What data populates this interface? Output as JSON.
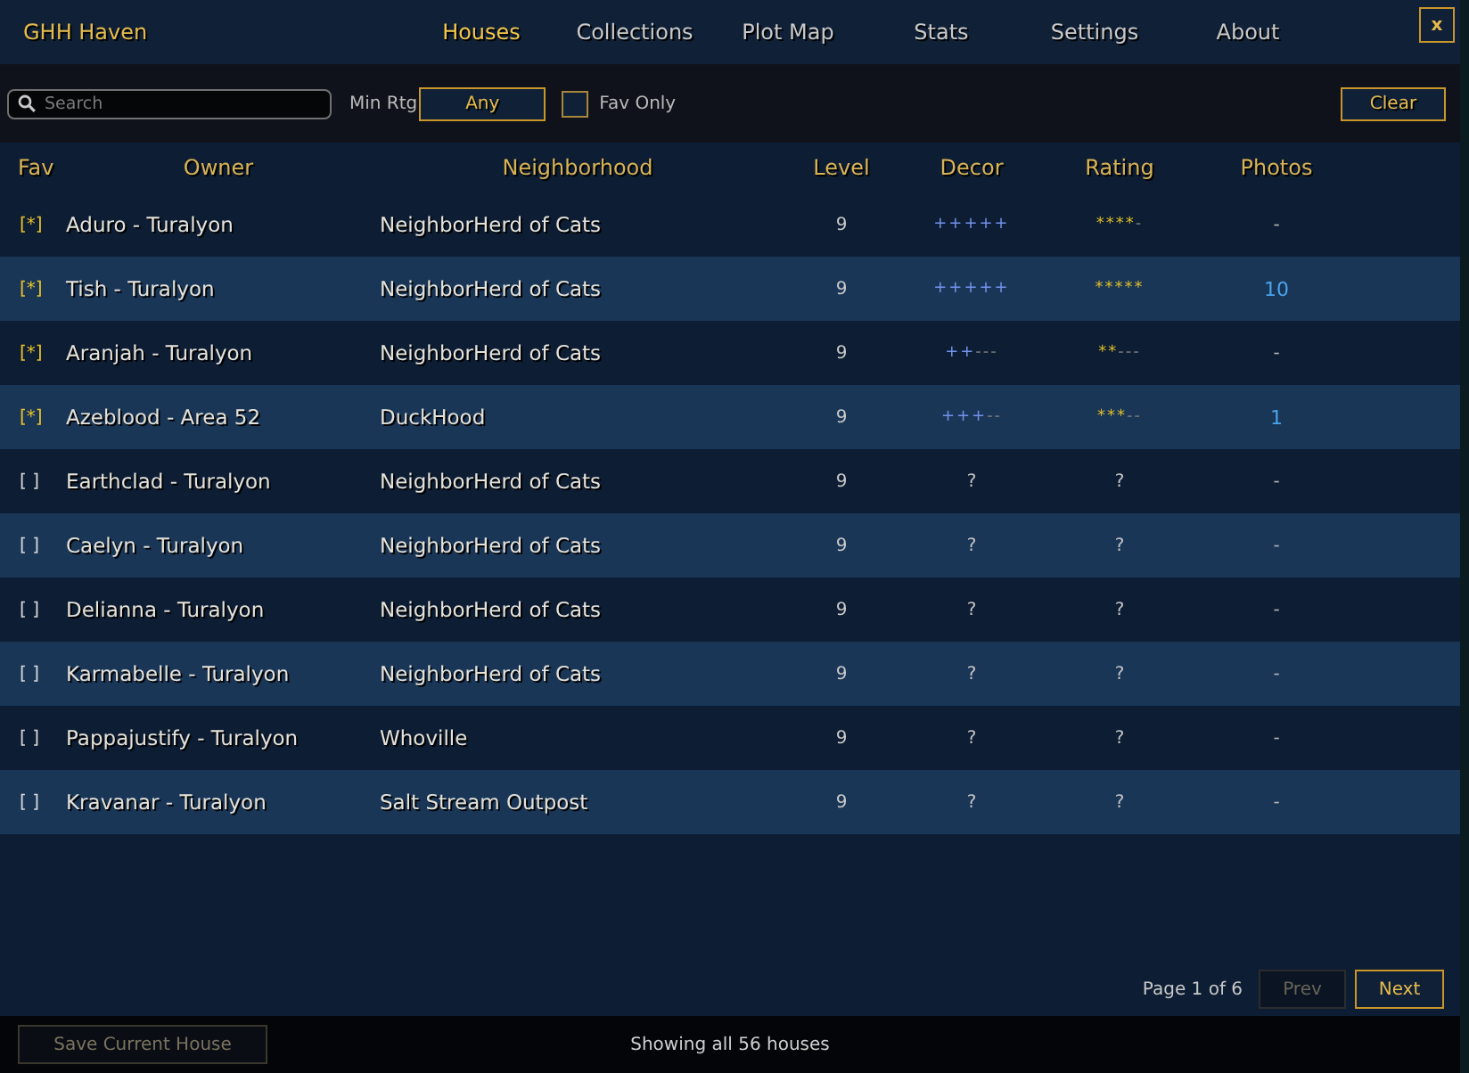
{
  "window": {
    "title": "GHH Haven",
    "close": "x"
  },
  "tabs": [
    {
      "label": "Houses",
      "selected": true
    },
    {
      "label": "Collections",
      "selected": false
    },
    {
      "label": "Plot Map",
      "selected": false
    },
    {
      "label": "Stats",
      "selected": false
    },
    {
      "label": "Settings",
      "selected": false
    },
    {
      "label": "About",
      "selected": false
    }
  ],
  "filters": {
    "search": {
      "placeholder": "Search"
    },
    "min_rating": {
      "label": "Min Rtg",
      "value": "Any"
    },
    "fav_only": {
      "label": "Fav Only",
      "checked": false
    },
    "clear": "Clear"
  },
  "table": {
    "columns": [
      "Fav",
      "Owner",
      "Neighborhood",
      "Level",
      "Decor",
      "Rating",
      "Photos"
    ],
    "rows": [
      {
        "fav": "[*]",
        "favorite": true,
        "owner": "Aduro - Turalyon",
        "neighborhood": "NeighborHerd of Cats",
        "level": "9",
        "decor": {
          "kind": "scale",
          "filled": "+++++"
        },
        "rating": {
          "kind": "scale",
          "filled": "****",
          "empty": "-"
        },
        "photos": {
          "kind": "none",
          "text": "-"
        }
      },
      {
        "fav": "[*]",
        "favorite": true,
        "owner": "Tish - Turalyon",
        "neighborhood": "NeighborHerd of Cats",
        "level": "9",
        "decor": {
          "kind": "scale",
          "filled": "+++++"
        },
        "rating": {
          "kind": "scale",
          "filled": "*****"
        },
        "photos": {
          "kind": "count",
          "text": "10"
        }
      },
      {
        "fav": "[*]",
        "favorite": true,
        "owner": "Aranjah - Turalyon",
        "neighborhood": "NeighborHerd of Cats",
        "level": "9",
        "decor": {
          "kind": "scale",
          "filled": "++",
          "empty": "---"
        },
        "rating": {
          "kind": "scale",
          "filled": "**",
          "empty": "---"
        },
        "photos": {
          "kind": "none",
          "text": "-"
        }
      },
      {
        "fav": "[*]",
        "favorite": true,
        "owner": "Azeblood - Area 52",
        "neighborhood": "DuckHood",
        "level": "9",
        "decor": {
          "kind": "scale",
          "filled": "+++",
          "empty": "--"
        },
        "rating": {
          "kind": "scale",
          "filled": "***",
          "empty": "--"
        },
        "photos": {
          "kind": "count",
          "text": "1"
        }
      },
      {
        "fav": "[ ]",
        "favorite": false,
        "owner": "Earthclad - Turalyon",
        "neighborhood": "NeighborHerd of Cats",
        "level": "9",
        "decor": {
          "kind": "unknown",
          "text": "?"
        },
        "rating": {
          "kind": "unknown",
          "text": "?"
        },
        "photos": {
          "kind": "none",
          "text": "-"
        }
      },
      {
        "fav": "[ ]",
        "favorite": false,
        "owner": "Caelyn - Turalyon",
        "neighborhood": "NeighborHerd of Cats",
        "level": "9",
        "decor": {
          "kind": "unknown",
          "text": "?"
        },
        "rating": {
          "kind": "unknown",
          "text": "?"
        },
        "photos": {
          "kind": "none",
          "text": "-"
        }
      },
      {
        "fav": "[ ]",
        "favorite": false,
        "owner": "Delianna - Turalyon",
        "neighborhood": "NeighborHerd of Cats",
        "level": "9",
        "decor": {
          "kind": "unknown",
          "text": "?"
        },
        "rating": {
          "kind": "unknown",
          "text": "?"
        },
        "photos": {
          "kind": "none",
          "text": "-"
        }
      },
      {
        "fav": "[ ]",
        "favorite": false,
        "owner": "Karmabelle - Turalyon",
        "neighborhood": "NeighborHerd of Cats",
        "level": "9",
        "decor": {
          "kind": "unknown",
          "text": "?"
        },
        "rating": {
          "kind": "unknown",
          "text": "?"
        },
        "photos": {
          "kind": "none",
          "text": "-"
        }
      },
      {
        "fav": "[ ]",
        "favorite": false,
        "owner": "Pappajustify - Turalyon",
        "neighborhood": "Whoville",
        "level": "9",
        "decor": {
          "kind": "unknown",
          "text": "?"
        },
        "rating": {
          "kind": "unknown",
          "text": "?"
        },
        "photos": {
          "kind": "none",
          "text": "-"
        }
      },
      {
        "fav": "[ ]",
        "favorite": false,
        "owner": "Kravanar - Turalyon",
        "neighborhood": "Salt Stream Outpost",
        "level": "9",
        "decor": {
          "kind": "unknown",
          "text": "?"
        },
        "rating": {
          "kind": "unknown",
          "text": "?"
        },
        "photos": {
          "kind": "none",
          "text": "-"
        }
      }
    ]
  },
  "pagination": {
    "page": "Page 1 of 6",
    "prev": {
      "label": "Prev",
      "disabled": true
    },
    "next": {
      "label": "Next",
      "disabled": false
    }
  },
  "footer": {
    "save": {
      "label": "Save Current House",
      "disabled": true
    },
    "status": "Showing all 56 houses"
  }
}
